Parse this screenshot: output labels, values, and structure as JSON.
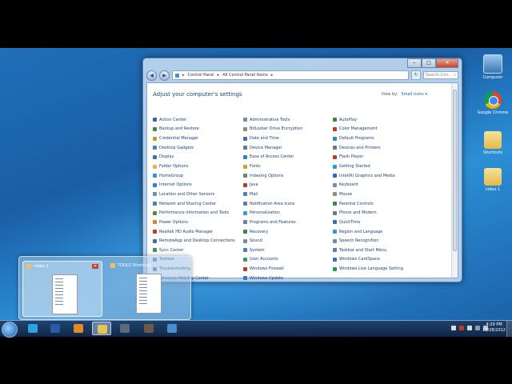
{
  "desktop": {
    "icons": [
      {
        "label": "Computer",
        "icon": "computer-icon"
      },
      {
        "label": "Google Chrome",
        "icon": "chrome-icon"
      },
      {
        "label": "Shortcuts",
        "icon": "folder-icon"
      },
      {
        "label": "video 1",
        "icon": "folder-icon"
      }
    ]
  },
  "window": {
    "breadcrumb": [
      "Control Panel",
      "All Control Panel Items"
    ],
    "search_placeholder": "Search Con...",
    "heading": "Adjust your computer's settings",
    "view_by_label": "View by:",
    "view_by_value": "Small icons ▾",
    "columns": [
      [
        {
          "label": "Action Center",
          "color": "#2a6bbf"
        },
        {
          "label": "Backup and Restore",
          "color": "#3a8a3a"
        },
        {
          "label": "Credential Manager",
          "color": "#c99a2e"
        },
        {
          "label": "Desktop Gadgets",
          "color": "#4a7fc1"
        },
        {
          "label": "Display",
          "color": "#3d6fb0"
        },
        {
          "label": "Folder Options",
          "color": "#e0b84a"
        },
        {
          "label": "HomeGroup",
          "color": "#2a9bd6"
        },
        {
          "label": "Internet Options",
          "color": "#2a7fd1"
        },
        {
          "label": "Location and Other Sensors",
          "color": "#6a8fb8"
        },
        {
          "label": "Network and Sharing Center",
          "color": "#3f7fc4"
        },
        {
          "label": "Performance Information and Tools",
          "color": "#5a8a3a"
        },
        {
          "label": "Power Options",
          "color": "#d08a2a"
        },
        {
          "label": "Realtek HD Audio Manager",
          "color": "#c0392b"
        },
        {
          "label": "RemoteApp and Desktop Connections",
          "color": "#3a6fb0"
        },
        {
          "label": "Sync Center",
          "color": "#2e9b4a"
        },
        {
          "label": "Taskbar",
          "color": "#5a7fb0"
        },
        {
          "label": "Troubleshooting",
          "color": "#4a7fc1"
        },
        {
          "label": "Windows Mobility Center",
          "color": "#4a7fc1"
        }
      ],
      [
        {
          "label": "Administrative Tools",
          "color": "#7a8a9a"
        },
        {
          "label": "BitLocker Drive Encryption",
          "color": "#8a8a8a"
        },
        {
          "label": "Date and Time",
          "color": "#3a6fb0"
        },
        {
          "label": "Device Manager",
          "color": "#6a7a8a"
        },
        {
          "label": "Ease of Access Center",
          "color": "#2a7fd1"
        },
        {
          "label": "Fonts",
          "color": "#d0a02a"
        },
        {
          "label": "Indexing Options",
          "color": "#6a8a6a"
        },
        {
          "label": "Java",
          "color": "#c0392b"
        },
        {
          "label": "Mail",
          "color": "#4a7fc1"
        },
        {
          "label": "Notification Area Icons",
          "color": "#5a7fb0"
        },
        {
          "label": "Personalization",
          "color": "#3a9bd6"
        },
        {
          "label": "Programs and Features",
          "color": "#6a7fa0"
        },
        {
          "label": "Recovery",
          "color": "#3a8a3a"
        },
        {
          "label": "Sound",
          "color": "#7a8a9a"
        },
        {
          "label": "System",
          "color": "#4a7fc1"
        },
        {
          "label": "User Accounts",
          "color": "#3a9b5a"
        },
        {
          "label": "Windows Firewall",
          "color": "#c0392b"
        },
        {
          "label": "Windows Update",
          "color": "#2a7fd1"
        }
      ],
      [
        {
          "label": "AutoPlay",
          "color": "#3a8a3a"
        },
        {
          "label": "Color Management",
          "color": "#c0392b"
        },
        {
          "label": "Default Programs",
          "color": "#3a7fc1"
        },
        {
          "label": "Devices and Printers",
          "color": "#6a7a8a"
        },
        {
          "label": "Flash Player",
          "color": "#c0392b"
        },
        {
          "label": "Getting Started",
          "color": "#2a9bd6"
        },
        {
          "label": "Intel(R) Graphics and Media",
          "color": "#2a6bbf"
        },
        {
          "label": "Keyboard",
          "color": "#7a8a9a"
        },
        {
          "label": "Mouse",
          "color": "#8a8a8a"
        },
        {
          "label": "Parental Controls",
          "color": "#3a8a3a"
        },
        {
          "label": "Phone and Modem",
          "color": "#6a7a8a"
        },
        {
          "label": "QuickTime",
          "color": "#3a6fb0"
        },
        {
          "label": "Region and Language",
          "color": "#2a9bd6"
        },
        {
          "label": "Speech Recognition",
          "color": "#7a8a9a"
        },
        {
          "label": "Taskbar and Start Menu",
          "color": "#5a7fb0"
        },
        {
          "label": "Windows CardSpace",
          "color": "#3a6fb0"
        },
        {
          "label": "Windows Live Language Setting",
          "color": "#2a9b4a"
        }
      ]
    ]
  },
  "thumbnails": [
    {
      "title": "video 1",
      "active": true
    },
    {
      "title": "TOOLS Shortcuts",
      "active": false
    }
  ],
  "taskbar": {
    "apps": [
      {
        "name": "skype",
        "icon": "skype-icon",
        "color": "#2aa3e0"
      },
      {
        "name": "word",
        "icon": "word-icon",
        "color": "#2b5aa8"
      },
      {
        "name": "media-player",
        "icon": "media-player-icon",
        "color": "#e08a2a"
      },
      {
        "name": "explorer",
        "icon": "folder-icon",
        "color": "#e8c45a"
      },
      {
        "name": "app-5",
        "icon": "app-icon",
        "color": "#5a6a7a"
      },
      {
        "name": "app-6",
        "icon": "app-icon",
        "color": "#6a5a4a"
      },
      {
        "name": "control-panel",
        "icon": "control-panel-icon",
        "color": "#4a8fd1"
      }
    ],
    "time": "4:29 PM",
    "date": "12/28/2012"
  }
}
